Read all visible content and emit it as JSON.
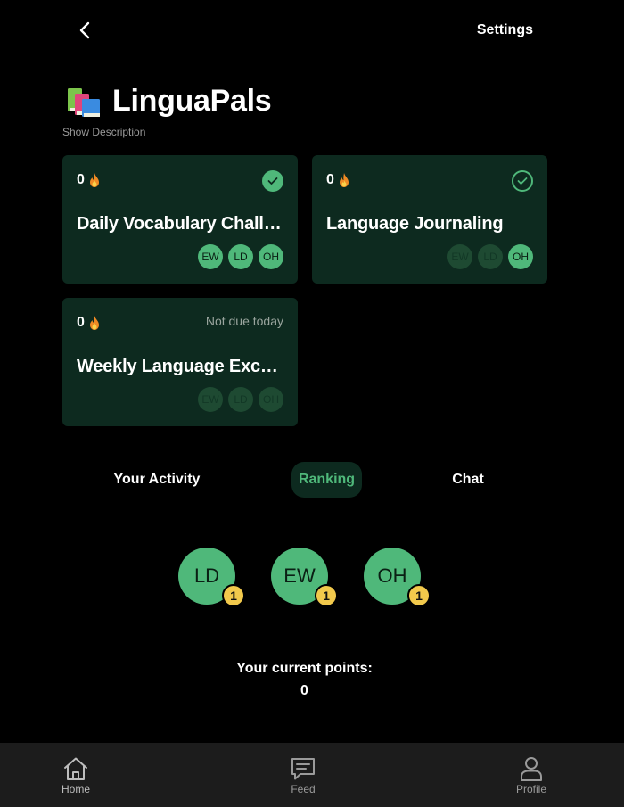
{
  "header": {
    "settings_label": "Settings"
  },
  "group": {
    "title": "LinguaPals",
    "show_description": "Show Description"
  },
  "habits": [
    {
      "streak": "0",
      "title": "Daily Vocabulary Challenge",
      "status": "done",
      "members": [
        "EW",
        "LD",
        "OH"
      ]
    },
    {
      "streak": "0",
      "title": "Language Journaling",
      "status": "done-outline",
      "members": [
        "EW",
        "LD",
        "OH"
      ]
    },
    {
      "streak": "0",
      "title": "Weekly Language Exchange",
      "status_text": "Not due today",
      "members": [
        "EW",
        "LD",
        "OH"
      ]
    }
  ],
  "tabs": [
    {
      "label": "Your Activity"
    },
    {
      "label": "Ranking",
      "active": true
    },
    {
      "label": "Chat"
    }
  ],
  "ranking": [
    {
      "initials": "LD",
      "rank": "1"
    },
    {
      "initials": "EW",
      "rank": "1"
    },
    {
      "initials": "OH",
      "rank": "1"
    }
  ],
  "points": {
    "label": "Your current points:",
    "value": "0"
  },
  "nav": {
    "home": "Home",
    "feed": "Feed",
    "profile": "Profile"
  },
  "colors": {
    "accent": "#4fb87a",
    "card_bg": "#0d2a1f",
    "badge": "#f2c94c",
    "background": "#000000"
  }
}
